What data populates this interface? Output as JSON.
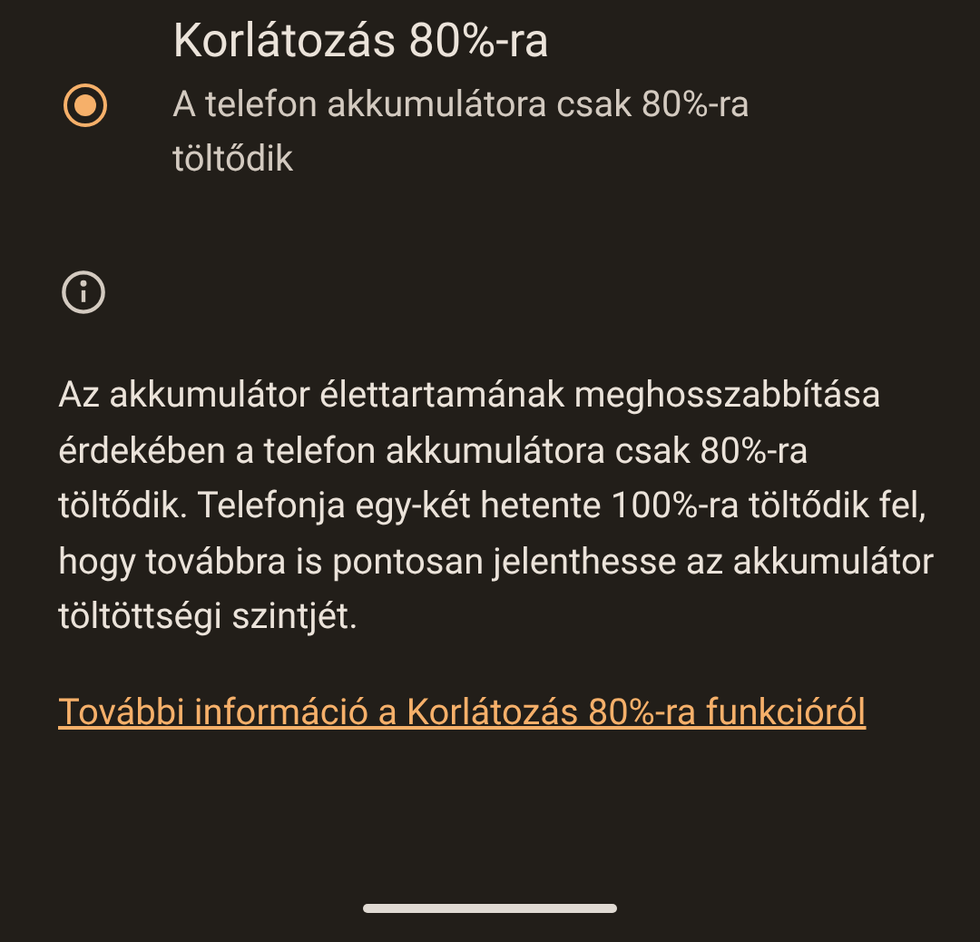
{
  "option": {
    "title": "Korlátozás 80%-ra",
    "description": "A telefon akkumulátora csak 80%-ra töltődik",
    "selected": true
  },
  "info": {
    "text": "Az akkumulátor élettartamának meghosszabbítása érdekében a telefon akkumulátora csak 80%-ra töltődik. Telefonja egy-két hetente 100%-ra töltődik fel, hogy továbbra is pontosan jelenthesse az akkumulátor töltöttségi szintjét.",
    "link": "További információ a Korlátozás 80%-ra funkcióról"
  }
}
